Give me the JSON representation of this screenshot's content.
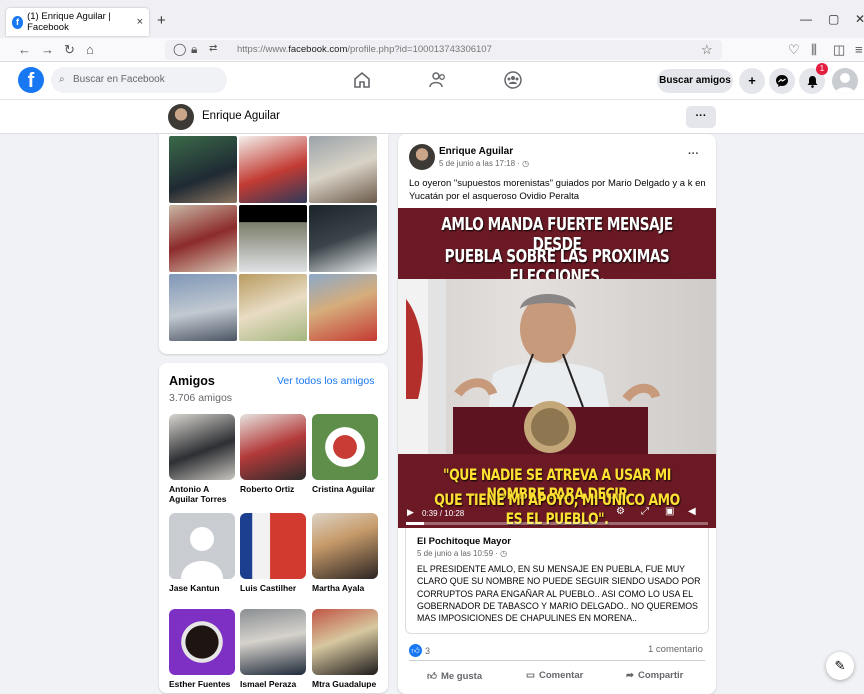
{
  "browser": {
    "tab_title": "(1) Enrique Aguilar | Facebook",
    "tab_close": "×",
    "new_tab": "+",
    "url_prefix": "https://www.",
    "url_domain": "facebook.com",
    "url_path": "/profile.php?id=100013743306107"
  },
  "header": {
    "search_placeholder": "Buscar en Facebook",
    "find_friends_label": "Buscar amigos",
    "create_label": "+",
    "notifications_count": "1",
    "logo_letter": "f"
  },
  "profile_bar": {
    "name": "Enrique Aguilar",
    "more_label": "···"
  },
  "friends": {
    "title": "Amigos",
    "count": "3.706 amigos",
    "see_all": "Ver todos los amigos",
    "list": [
      {
        "name": "Antonio A Aguilar Torres"
      },
      {
        "name": "Roberto Ortiz"
      },
      {
        "name": "Cristina Aguilar"
      },
      {
        "name": "Jase Kantun"
      },
      {
        "name": "Luis Castilher"
      },
      {
        "name": "Martha Ayala"
      },
      {
        "name": "Esther Fuentes"
      },
      {
        "name": "Ismael Peraza"
      },
      {
        "name": "Mtra Guadalupe"
      }
    ]
  },
  "post": {
    "author": "Enrique Aguilar",
    "date": "5 de junio a las 17:18 · ◷",
    "more": "···",
    "text": "Lo oyeron \"supuestos morenistas\" guiados por Mario Delgado y a k en Yucatán por el asqueroso Ovidio Peralta",
    "video": {
      "headline_1": "AMLO MANDA FUERTE MENSAJE DESDE",
      "headline_2": "PUEBLA SOBRE LAS PROXIMAS ELECCIONES.",
      "caption_1": "\"QUE NADIE SE ATREVA A USAR MI NOMBRE PARA DECIR",
      "caption_2": "QUE TIENE MI APOYO, MI UNICO AMO ES EL PUEBLO\".",
      "timecode": "0:39 / 10:28",
      "progress": 0.06
    },
    "shared": {
      "author": "El Pochitoque Mayor",
      "date": "5 de junio a las 10:59 · ◷",
      "text": "EL PRESIDENTE AMLO, EN SU MENSAJE EN PUEBLA, FUE MUY CLARO QUE SU NOMBRE NO PUEDE SEGUIR SIENDO USADO POR CORRUPTOS PARA ENGAÑAR AL PUEBLO.. ASI COMO LO USA EL GOBERNADOR DE TABASCO Y MARIO DELGADO.. NO QUEREMOS MAS IMPOSICIONES DE CHAPULINES EN MORENA.."
    },
    "reactions_count": "3",
    "comments_count": "1 comentario",
    "like_label": "Me gusta",
    "comment_label": "Comentar",
    "share_label": "Compartir"
  },
  "colors": {
    "brand": "#1877f2",
    "video_bg": "#6b1a25",
    "badge": "#e41e3f"
  }
}
